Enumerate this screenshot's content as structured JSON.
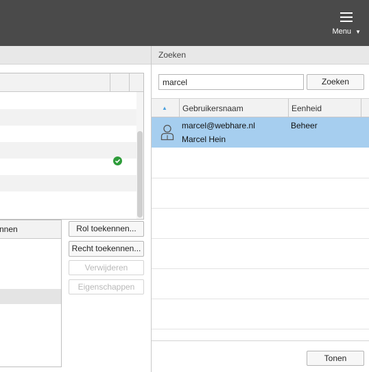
{
  "topbar": {
    "menu_label": "Menu",
    "menu_caret": "▼",
    "menu_icon": "hamburger-icon"
  },
  "left": {
    "table_header_partial": "nnen",
    "buttons": {
      "rol_toekennen": "Rol toekennen...",
      "recht_toekennen": "Recht toekennen...",
      "verwijderen": "Verwijderen",
      "eigenschappen": "Eigenschappen"
    },
    "check_icon": "check-circle-icon"
  },
  "search": {
    "title": "Zoeken",
    "input_value": "marcel",
    "button_label": "Zoeken",
    "columns": {
      "sort_indicator": "▲",
      "username": "Gebruikersnaam",
      "unit": "Eenheid"
    },
    "results": [
      {
        "icon": "user-icon",
        "username": "marcel@webhare.nl",
        "fullname": "Marcel Hein",
        "unit": "Beheer",
        "selected": true
      }
    ],
    "footer_button": "Tonen"
  },
  "colors": {
    "topbar": "#4a4a4a",
    "selection": "#a6ceef",
    "check": "#2e9c3a",
    "sort_arrow": "#4aa0dd"
  }
}
